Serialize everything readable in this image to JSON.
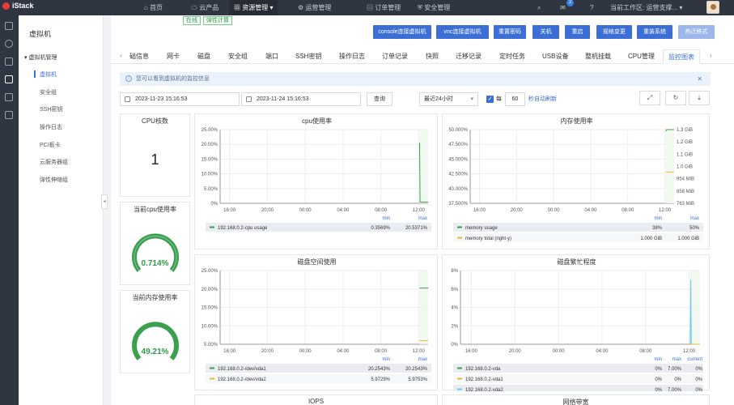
{
  "topbar": {
    "logo": "iStack",
    "nav": [
      "首页",
      "云产品",
      "资源管理",
      "运营管理",
      "订单管理",
      "安全管理"
    ],
    "badge": "2",
    "workspace": "当前工作区: 运营支撑..."
  },
  "menu": {
    "title": "虚拟机",
    "group": "虚拟机管理",
    "items": [
      "虚拟机",
      "安全组",
      "SSH密钥",
      "操作日志",
      "PCI板卡",
      "云服务器组",
      "弹性伸缩组"
    ]
  },
  "tags": [
    "在线",
    "弹性计算"
  ],
  "buttons": [
    "console连接虚拟机",
    "vnc连接虚拟机",
    "重置密码",
    "关机",
    "重启",
    "规格变更",
    "重装系统",
    "热迁移式"
  ],
  "tabs": [
    "础信息",
    "网卡",
    "磁盘",
    "安全组",
    "端口",
    "SSH密钥",
    "操作日志",
    "订单记录",
    "快照",
    "迁移记录",
    "定时任务",
    "USB设备",
    "整机挂载",
    "CPU管理",
    "监控图表"
  ],
  "info": "您可以看到虚拟机的监控信息",
  "filters": {
    "start": "2023-11-23 15:16:53",
    "end": "2023-11-24 15:16:53",
    "query": "查询",
    "range": "最近24小时",
    "every": "每",
    "interval": "60",
    "auto": "秒自动刷新"
  },
  "cpu_count": {
    "title": "CPU核数",
    "value": "1"
  },
  "cpu_gauge": {
    "title": "当前cpu使用率",
    "value": "0.714%",
    "fraction": 0.00714
  },
  "mem_gauge": {
    "title": "当前内存使用率",
    "value": "49.21%",
    "fraction": 0.4921
  },
  "colors": {
    "primary": "#3b6fd6",
    "green": "#3aa04f",
    "yellow": "#f0b43a",
    "cyan": "#6ec6e6"
  },
  "chart_data": [
    {
      "type": "line",
      "title": "cpu使用率",
      "xticks": [
        "16:00",
        "20:00",
        "00:00",
        "04:00",
        "08:00",
        "12:00"
      ],
      "yticks": [
        "25.00%",
        "20.00%",
        "15.00%",
        "10.00%",
        "5.00%",
        "0%"
      ],
      "ylim": [
        0,
        25
      ],
      "series": [
        {
          "name": "192.168.0.2-cpu usage",
          "color": "#3aa04f",
          "x_start": 12.1,
          "points": [
            [
              12.1,
              20.5
            ],
            [
              12.15,
              0.4
            ],
            [
              13.0,
              0.4
            ]
          ]
        }
      ],
      "legend_headers": [
        "min",
        "max"
      ],
      "legend_rows": [
        [
          "192.168.0.2-cpu usage",
          "0.3569%",
          "20.5371%"
        ]
      ]
    },
    {
      "type": "line",
      "title": "内存使用率",
      "xticks": [
        "16:00",
        "20:00",
        "00:00",
        "04:00",
        "08:00",
        "12:00"
      ],
      "yticks": [
        "50.000%",
        "47.500%",
        "45.000%",
        "42.500%",
        "40.000%",
        "37.500%"
      ],
      "y2ticks": [
        "1.3 GiB",
        "1.2 GiB",
        "1.1 GiB",
        "1.0 GiB",
        "954 MiB",
        "858 MiB",
        "763 MiB"
      ],
      "ylim": [
        37.5,
        50
      ],
      "series": [
        {
          "name": "memory usage",
          "color": "#3aa04f",
          "points": [
            [
              12.1,
              49.7
            ],
            [
              12.2,
              50.0
            ],
            [
              13.0,
              50.0
            ]
          ]
        },
        {
          "name": "memory total",
          "color": "#f0b43a",
          "points": [
            [
              12.1,
              42.8
            ],
            [
              13.0,
              42.8
            ]
          ]
        }
      ],
      "legend_headers": [
        "min",
        "max"
      ],
      "legend_rows": [
        [
          "memory usage",
          "38%",
          "50%"
        ],
        [
          "memory total (right-y)",
          "1.000 GiB",
          "1.000 GiB"
        ]
      ]
    },
    {
      "type": "line",
      "title": "磁盘空间使用",
      "xticks": [
        "16:00",
        "20:00",
        "00:00",
        "04:00",
        "08:00",
        "12:00"
      ],
      "yticks": [
        "25.00%",
        "20.00%",
        "15.00%",
        "10.00%",
        "5.00%"
      ],
      "ylim": [
        5,
        25
      ],
      "series": [
        {
          "name": "192.168.0.2-/dev/vda1",
          "color": "#3aa04f",
          "points": [
            [
              12.1,
              20.25
            ],
            [
              13.0,
              20.25
            ]
          ]
        },
        {
          "name": "192.168.0.2-/dev/vda2",
          "color": "#f0b43a",
          "points": [
            [
              12.1,
              5.97
            ],
            [
              13.0,
              5.97
            ]
          ]
        }
      ],
      "legend_headers": [
        "min",
        "max"
      ],
      "legend_rows": [
        [
          "192.168.0.2-/dev/vda1",
          "20.2543%",
          "20.2543%"
        ],
        [
          "192.168.0.2-/dev/vda2",
          "5.9729%",
          "5.9753%"
        ]
      ]
    },
    {
      "type": "line",
      "title": "磁盘繁忙程度",
      "xticks": [
        "16:00",
        "20:00",
        "00:00",
        "04:00",
        "08:00",
        "12:00"
      ],
      "yticks": [
        "8%",
        "6%",
        "4%",
        "2%",
        "0%"
      ],
      "ylim": [
        0,
        8
      ],
      "series": [
        {
          "name": "192.168.0.2-vda",
          "color": "#6ec6e6",
          "points": [
            [
              12.1,
              0
            ],
            [
              12.15,
              7
            ],
            [
              12.2,
              0
            ],
            [
              13.0,
              0
            ]
          ]
        },
        {
          "name": "192.168.0.2-vda1",
          "color": "#f0b43a",
          "points": [
            [
              12.1,
              0
            ],
            [
              13.0,
              0
            ]
          ]
        }
      ],
      "legend_headers": [
        "min",
        "max",
        "current"
      ],
      "legend_rows": [
        [
          "192.168.0.2-vda",
          "0%",
          "7.00%",
          "0%"
        ],
        [
          "192.168.0.2-vda1",
          "0%",
          "0%",
          "0%"
        ],
        [
          "192.168.0.2-vda2",
          "0%",
          "7.00%",
          "0%"
        ]
      ]
    }
  ],
  "bottom_titles": [
    "IOPS",
    "网络带宽"
  ]
}
